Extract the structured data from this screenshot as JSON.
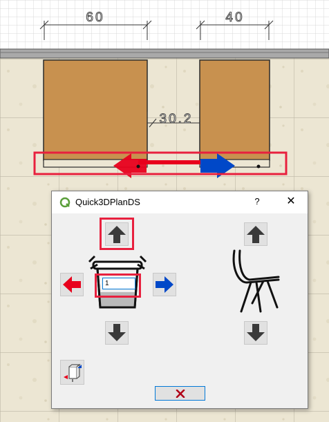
{
  "plan": {
    "dimension_left": "60",
    "dimension_right": "40",
    "dimension_gap": "30.2"
  },
  "dialog": {
    "title": "Quick3DPlanDS",
    "help_label": "?",
    "close_label": "✕",
    "quantity_value": "1",
    "icons": {
      "app": "q-logo-icon",
      "up": "arrow-up-icon",
      "down": "arrow-down-icon",
      "left": "arrow-left-red-icon",
      "right": "arrow-right-blue-icon",
      "table": "table-icon",
      "chair": "chair-icon",
      "rotate": "rotate-view-icon",
      "cancel": "red-x-icon"
    }
  },
  "colors": {
    "highlight": "#e8203e",
    "arrow_red": "#e8001c",
    "arrow_blue": "#0048c8",
    "cabinet": "#c8914f",
    "dialog_bg": "#f0f0f0"
  }
}
